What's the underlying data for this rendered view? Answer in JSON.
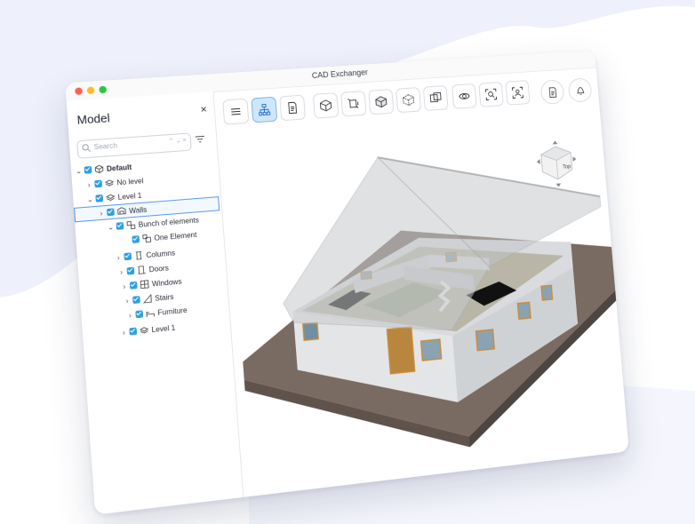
{
  "app": {
    "title": "CAD Exchanger"
  },
  "panel": {
    "title": "Model",
    "close_label": "×",
    "search": {
      "placeholder": "Search",
      "controls": "⌃ ⌄ ×"
    }
  },
  "tree": [
    {
      "label": "Default",
      "bold": true,
      "chevron": "⌄",
      "icon": "cube-icon"
    },
    {
      "label": "No level",
      "chevron": "›",
      "icon": "layers-icon"
    },
    {
      "label": "Level 1",
      "chevron": "⌄",
      "icon": "layers-icon",
      "selected": true
    },
    {
      "label": "Walls",
      "chevron": "›",
      "icon": "walls-icon",
      "selected_outline": true
    },
    {
      "label": "Bunch of elements",
      "chevron": "⌄",
      "icon": "group-icon"
    },
    {
      "label": "One Element",
      "chevron": "",
      "icon": "element-icon"
    },
    {
      "label": "Columns",
      "chevron": "›",
      "icon": "column-icon"
    },
    {
      "label": "Doors",
      "chevron": "›",
      "icon": "door-icon"
    },
    {
      "label": "Windows",
      "chevron": "›",
      "icon": "window-icon"
    },
    {
      "label": "Stairs",
      "chevron": "›",
      "icon": "stairs-icon"
    },
    {
      "label": "Furniture",
      "chevron": "›",
      "icon": "furniture-icon"
    },
    {
      "label": "Level 1",
      "chevron": "›",
      "icon": "layers-icon"
    }
  ],
  "toolbar": {
    "buttons": [
      "menu-icon",
      "structure-icon",
      "document-icon",
      "box-section-icon",
      "box-explode-icon",
      "box-shaded-icon",
      "box-wire-icon",
      "box-edges-icon",
      "eye-icon",
      "zoom-fit-icon",
      "fit-person-icon"
    ],
    "active": "structure-icon",
    "right_buttons": [
      "notes-icon",
      "bell-icon"
    ]
  },
  "viewcube": {
    "face_label": "Top"
  },
  "colors": {
    "accent": "#2f9fe0",
    "background_blob": "#eef0fb",
    "ground": "#7a6b62",
    "wall": "#d9dbde",
    "roof": "#c8cacd",
    "window_frame": "#c98b3c"
  }
}
